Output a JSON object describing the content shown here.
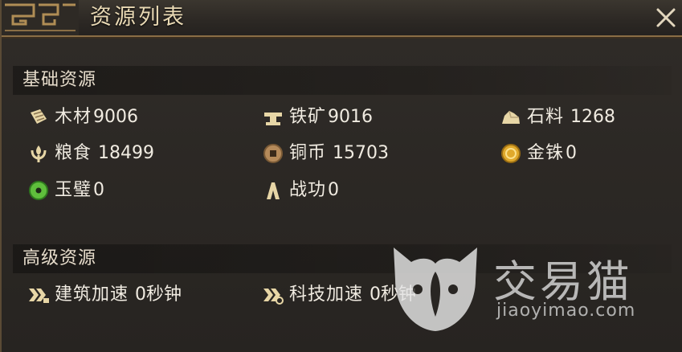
{
  "window": {
    "title": "资源列表",
    "close_icon": "close-icon"
  },
  "basic": {
    "heading": "基础资源",
    "items": [
      {
        "icon": "wood-icon",
        "label": "木材",
        "value": "9006"
      },
      {
        "icon": "iron-ore-icon",
        "label": "铁矿",
        "value": "9016"
      },
      {
        "icon": "stone-icon",
        "label": "石料",
        "value": "1268"
      },
      {
        "icon": "grain-icon",
        "label": "粮食",
        "value": "18499"
      },
      {
        "icon": "copper-coin-icon",
        "label": "铜币",
        "value": "15703"
      },
      {
        "icon": "gold-bead-icon",
        "label": "金铢",
        "value": "0"
      },
      {
        "icon": "jade-bi-icon",
        "label": "玉璧",
        "value": "0"
      },
      {
        "icon": "merit-icon",
        "label": "战功",
        "value": "0"
      }
    ]
  },
  "advanced": {
    "heading": "高级资源",
    "items": [
      {
        "icon": "build-speedup-icon",
        "label": "建筑加速",
        "value": "0秒钟"
      },
      {
        "icon": "tech-speedup-icon",
        "label": "科技加速",
        "value": "0秒钟"
      }
    ]
  },
  "watermark": {
    "cn": "交易猫",
    "en": "jiaoyimao.com"
  },
  "colors": {
    "title_text": "#e9d9b4",
    "item_text": "#f0ebe1",
    "border_gold": "#8a6e45"
  }
}
